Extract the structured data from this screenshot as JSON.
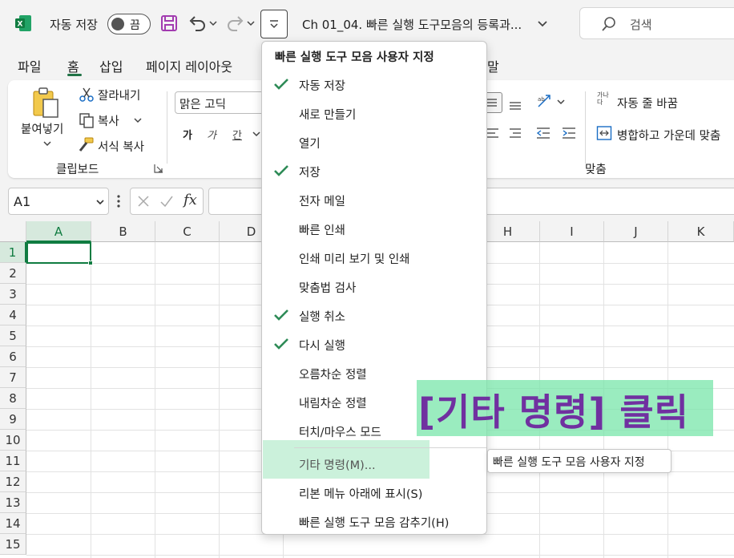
{
  "titlebar": {
    "autosave_label": "자동 저장",
    "autosave_state": "끔",
    "doc_title": "Ch 01_04. 빠른 실행 도구모음의 등록과...",
    "search_placeholder": "검색",
    "excel_color": "#107c41",
    "save_icon_color": "#a23bb0"
  },
  "tabs": [
    "파일",
    "홈",
    "삽입",
    "페이지 레이아웃",
    "말"
  ],
  "ribbon": {
    "paste": "붙여넣기",
    "cut": "잘라내기",
    "copy": "복사",
    "format_painter": "서식 복사",
    "clipboard_group": "클립보드",
    "font_name": "맑은 고딕",
    "font_bold": "가",
    "font_italic": "가",
    "font_underline": "간",
    "wrap_text": "자동 줄 바꿈",
    "merge_center": "병합하고 가운데 맞춤",
    "wrap_icon_text": "가나 다",
    "align_group": "맞춤"
  },
  "formula_bar": {
    "namebox": "A1",
    "fx": "fx"
  },
  "grid": {
    "columns": [
      "A",
      "B",
      "C",
      "D",
      "H",
      "I",
      "J",
      "K"
    ],
    "rows": [
      "1",
      "2",
      "3",
      "4",
      "5",
      "6",
      "7",
      "8",
      "9",
      "10",
      "11",
      "12",
      "13",
      "14",
      "15"
    ]
  },
  "menu": {
    "title": "빠른 실행 도구 모음 사용자 지정",
    "items": [
      {
        "label": "자동 저장",
        "checked": true
      },
      {
        "label": "새로 만들기",
        "checked": false
      },
      {
        "label": "열기",
        "checked": false
      },
      {
        "label": "저장",
        "checked": true
      },
      {
        "label": "전자 메일",
        "checked": false
      },
      {
        "label": "빠른 인쇄",
        "checked": false
      },
      {
        "label": "인쇄 미리 보기 및 인쇄",
        "checked": false
      },
      {
        "label": "맞춤법 검사",
        "checked": false
      },
      {
        "label": "실행 취소",
        "checked": true
      },
      {
        "label": "다시 실행",
        "checked": true
      },
      {
        "label": "오름차순 정렬",
        "checked": false
      },
      {
        "label": "내림차순 정렬",
        "checked": false
      },
      {
        "label": "터치/마우스 모드",
        "checked": false
      },
      {
        "label": "기타 명령(M)...",
        "checked": false
      },
      {
        "label": "리본 메뉴 아래에 표시(S)",
        "checked": false
      },
      {
        "label": "빠른 실행 도구 모음 감추기(H)",
        "checked": false
      }
    ],
    "check_color": "#2e8b57"
  },
  "tooltip": "빠른 실행 도구 모음 사용자 지정",
  "annotation": "[기타 명령] 클릭"
}
